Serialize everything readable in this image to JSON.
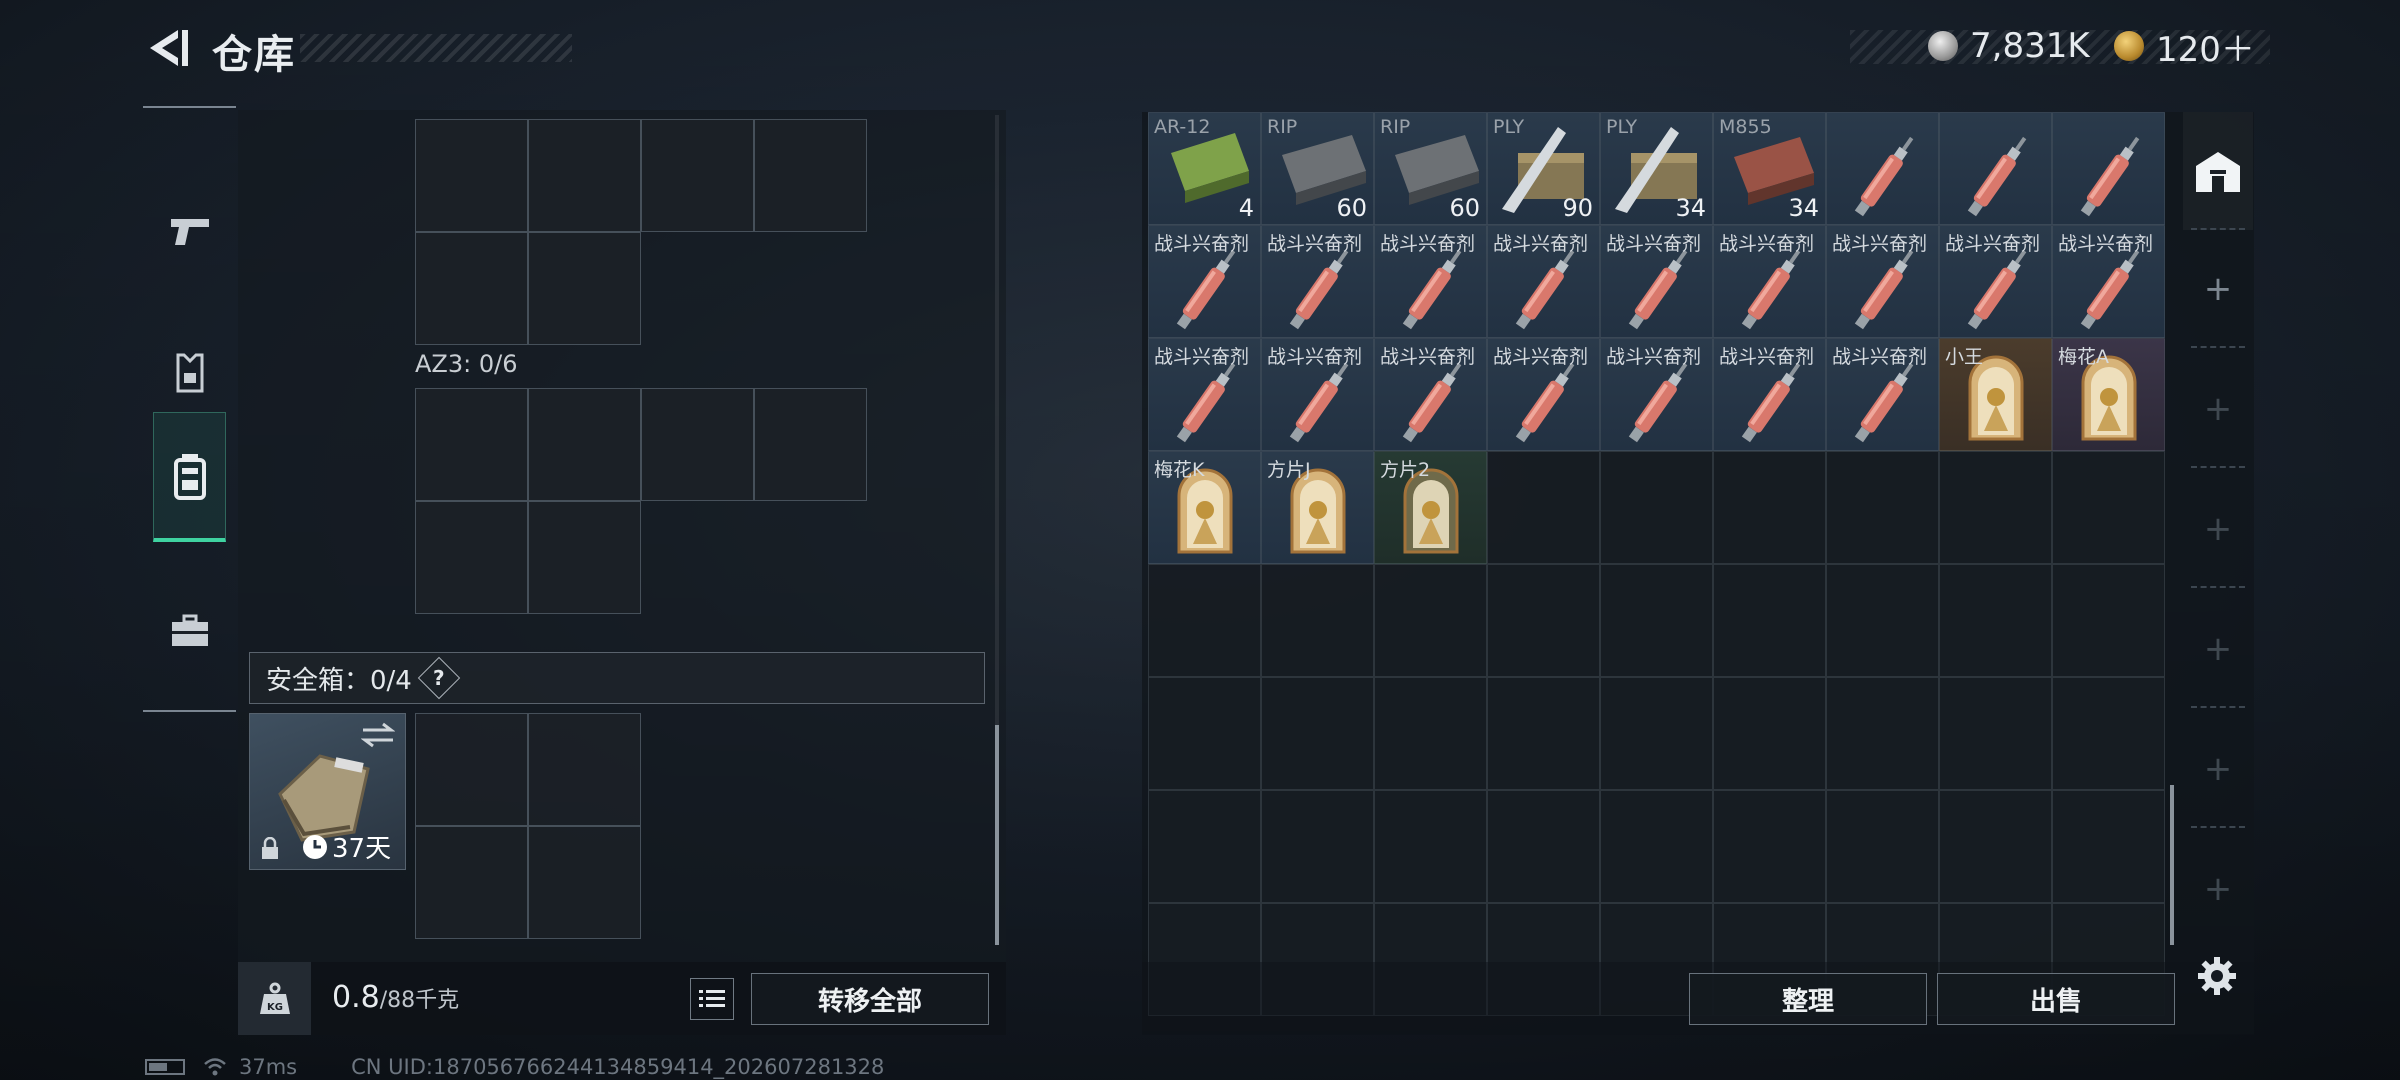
{
  "header": {
    "title": "仓库",
    "silver_amount": "7,831K",
    "gold_amount": "120＋"
  },
  "left_nav": {
    "items": [
      {
        "name": "weapon",
        "icon": "pistol-icon"
      },
      {
        "name": "armor",
        "icon": "vest-icon"
      },
      {
        "name": "backpack",
        "icon": "backpack-icon",
        "active": true
      },
      {
        "name": "toolbox",
        "icon": "briefcase-icon"
      }
    ]
  },
  "loadout": {
    "az3_label": "AZ3: 0/6",
    "safebox_label": "安全箱：0/4",
    "safebox_help": "?",
    "safebox_days": "37天",
    "weight_value": "0.8",
    "weight_capacity": "/88千克",
    "transfer_all_label": "转移全部"
  },
  "stash": {
    "items": [
      {
        "name": "AR-12",
        "count": "4",
        "kind": "ammo-green"
      },
      {
        "name": "RIP",
        "count": "60",
        "kind": "ammo-grey"
      },
      {
        "name": "RIP",
        "count": "60",
        "kind": "ammo-grey"
      },
      {
        "name": "PLY",
        "count": "90",
        "kind": "ammo-knife"
      },
      {
        "name": "PLY",
        "count": "34",
        "kind": "ammo-knife"
      },
      {
        "name": "M855",
        "count": "34",
        "kind": "ammo-red"
      },
      {
        "name": "",
        "count": "",
        "kind": "injector"
      },
      {
        "name": "",
        "count": "",
        "kind": "injector"
      },
      {
        "name": "",
        "count": "",
        "kind": "injector"
      },
      {
        "name": "战斗兴奋剂",
        "count": "",
        "kind": "injector"
      },
      {
        "name": "战斗兴奋剂",
        "count": "",
        "kind": "injector"
      },
      {
        "name": "战斗兴奋剂",
        "count": "",
        "kind": "injector"
      },
      {
        "name": "战斗兴奋剂",
        "count": "",
        "kind": "injector"
      },
      {
        "name": "战斗兴奋剂",
        "count": "",
        "kind": "injector"
      },
      {
        "name": "战斗兴奋剂",
        "count": "",
        "kind": "injector"
      },
      {
        "name": "战斗兴奋剂",
        "count": "",
        "kind": "injector"
      },
      {
        "name": "战斗兴奋剂",
        "count": "",
        "kind": "injector"
      },
      {
        "name": "战斗兴奋剂",
        "count": "",
        "kind": "injector"
      },
      {
        "name": "战斗兴奋剂",
        "count": "",
        "kind": "injector"
      },
      {
        "name": "战斗兴奋剂",
        "count": "",
        "kind": "injector"
      },
      {
        "name": "战斗兴奋剂",
        "count": "",
        "kind": "injector"
      },
      {
        "name": "战斗兴奋剂",
        "count": "",
        "kind": "injector"
      },
      {
        "name": "战斗兴奋剂",
        "count": "",
        "kind": "injector"
      },
      {
        "name": "战斗兴奋剂",
        "count": "",
        "kind": "injector"
      },
      {
        "name": "战斗兴奋剂",
        "count": "",
        "kind": "injector"
      },
      {
        "name": "小王",
        "count": "",
        "kind": "card-gold"
      },
      {
        "name": "梅花A",
        "count": "",
        "kind": "card-purple"
      },
      {
        "name": "梅花K",
        "count": "",
        "kind": "card-blue"
      },
      {
        "name": "方片J",
        "count": "",
        "kind": "card-blue"
      },
      {
        "name": "方片2",
        "count": "",
        "kind": "card-green"
      }
    ],
    "organize_label": "整理",
    "sell_label": "出售"
  },
  "status_bar": {
    "ping": "37ms",
    "uid": "CN UID:18705676624413485941­4_202607281328"
  },
  "colors": {
    "accent": "#3fd3a1",
    "panel": "#1a2027",
    "border": "#46505a"
  }
}
